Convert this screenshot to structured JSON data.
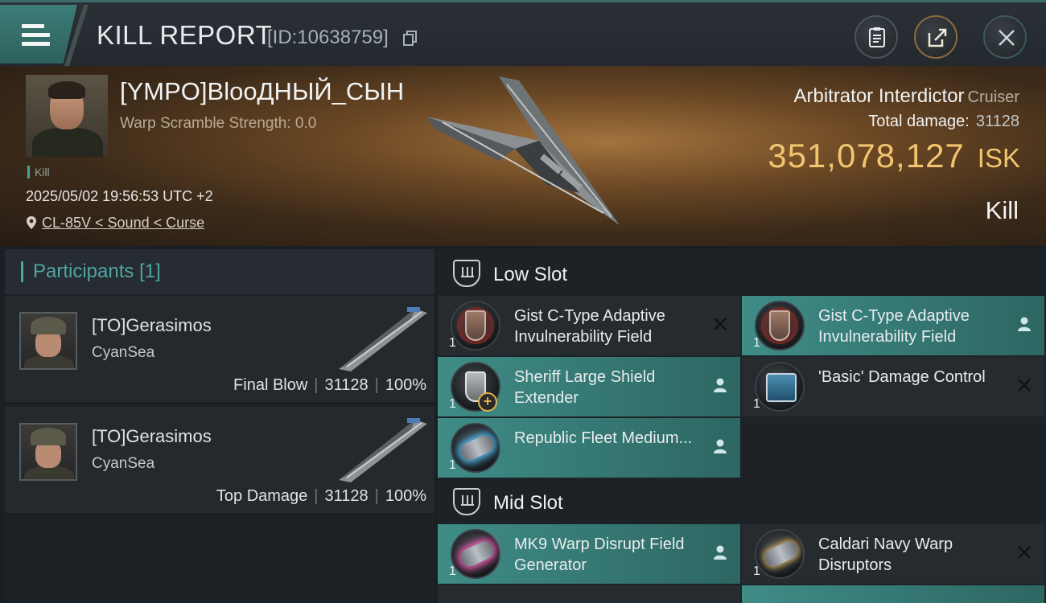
{
  "header": {
    "title": "KILL REPORT",
    "report_id": "[ID:10638759]"
  },
  "victim": {
    "name": "[YMPO]BlooДНЫЙ_СЫН",
    "warp_scramble": "Warp Scramble Strength: 0.0",
    "kill_tag": "Kill",
    "timestamp": "2025/05/02 19:56:53 UTC +2",
    "location": "CL-85V < Sound < Curse",
    "ship_name": "Arbitrator Interdictor",
    "ship_class": "Cruiser",
    "total_damage_label": "Total damage:",
    "total_damage": "31128",
    "isk_value": "351,078,127",
    "isk_unit": "ISK",
    "result": "Kill"
  },
  "participants": {
    "title": "Participants",
    "count": "[1]",
    "items": [
      {
        "name": "[TO]Gerasimos",
        "corp": "CyanSea",
        "role": "Final Blow",
        "damage": "31128",
        "percent": "100%"
      },
      {
        "name": "[TO]Gerasimos",
        "corp": "CyanSea",
        "role": "Top Damage",
        "damage": "31128",
        "percent": "100%"
      }
    ]
  },
  "fitting": {
    "low_slot": {
      "label": "Low Slot",
      "modules": [
        {
          "name": "Gist C-Type Adaptive Invulnerability Field",
          "qty": "1",
          "state": "destroyed",
          "icon": "shield-hardener-icon"
        },
        {
          "name": "Gist C-Type Adaptive Invulnerability Field",
          "qty": "1",
          "state": "dropped",
          "icon": "shield-hardener-icon"
        },
        {
          "name": "Sheriff Large Shield Extender",
          "qty": "1",
          "state": "dropped",
          "icon": "shield-extender-icon"
        },
        {
          "name": "'Basic' Damage Control",
          "qty": "1",
          "state": "destroyed",
          "icon": "damage-control-icon"
        },
        {
          "name": "Republic Fleet Medium...",
          "qty": "1",
          "state": "dropped",
          "icon": "afterburner-icon"
        }
      ]
    },
    "mid_slot": {
      "label": "Mid Slot",
      "modules": [
        {
          "name": "MK9 Warp Disrupt Field Generator",
          "qty": "1",
          "state": "dropped",
          "icon": "warp-disrupt-field-icon"
        },
        {
          "name": "Caldari Navy Warp Disruptors",
          "qty": "1",
          "state": "destroyed",
          "icon": "warp-disruptor-icon"
        }
      ]
    }
  },
  "colors": {
    "accent": "#4fa6a0",
    "isk": "#f1c46e",
    "dropped_bg": "#3f8c87"
  }
}
